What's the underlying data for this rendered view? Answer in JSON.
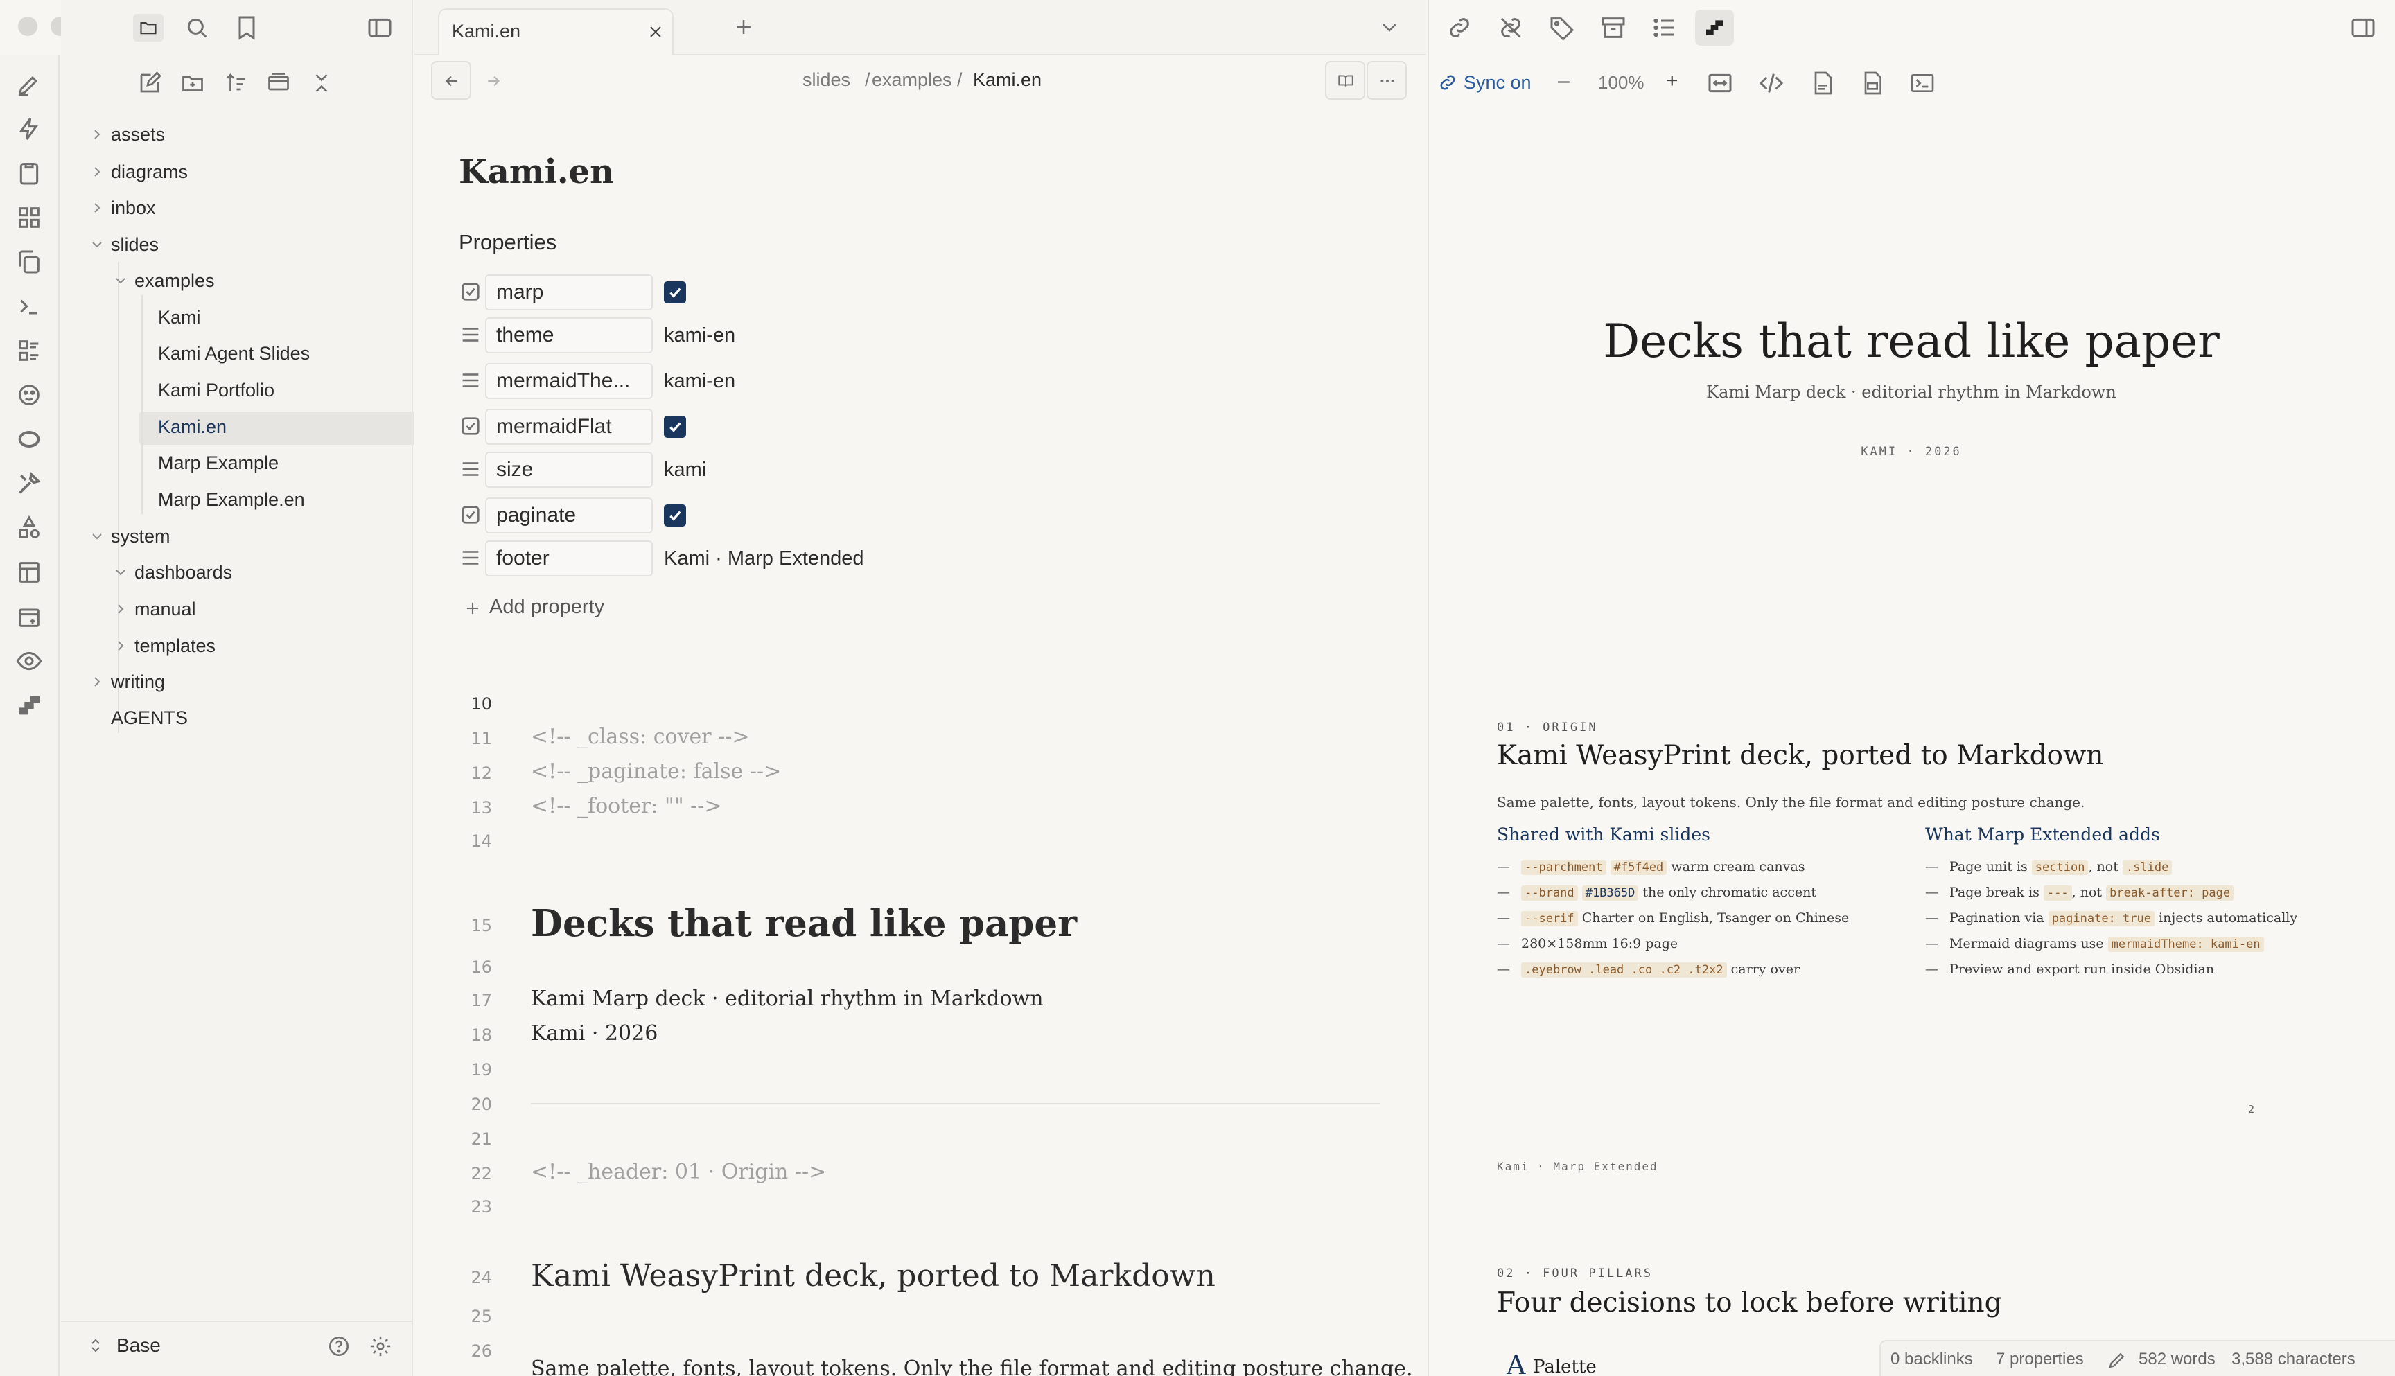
{
  "sidebar": {
    "tree": [
      {
        "label": "assets",
        "type": "folder",
        "expanded": false
      },
      {
        "label": "diagrams",
        "type": "folder",
        "expanded": false
      },
      {
        "label": "inbox",
        "type": "folder",
        "expanded": false
      },
      {
        "label": "slides",
        "type": "folder",
        "expanded": true
      },
      {
        "label": "examples",
        "type": "folder",
        "expanded": true
      },
      {
        "label": "Kami",
        "type": "file"
      },
      {
        "label": "Kami Agent Slides",
        "type": "file"
      },
      {
        "label": "Kami Portfolio",
        "type": "file"
      },
      {
        "label": "Kami.en",
        "type": "file",
        "active": true
      },
      {
        "label": "Marp Example",
        "type": "file"
      },
      {
        "label": "Marp Example.en",
        "type": "file"
      },
      {
        "label": "system",
        "type": "folder",
        "expanded": true
      },
      {
        "label": "dashboards",
        "type": "folder",
        "expanded": true
      },
      {
        "label": "manual",
        "type": "folder",
        "expanded": false
      },
      {
        "label": "templates",
        "type": "folder",
        "expanded": false
      },
      {
        "label": "writing",
        "type": "folder",
        "expanded": false
      },
      {
        "label": "AGENTS",
        "type": "file"
      }
    ],
    "vault_name": "Base"
  },
  "editor": {
    "tab_title": "Kami.en",
    "breadcrumb": [
      "slides",
      "examples",
      "Kami.en"
    ],
    "breadcrumb_sep": "/",
    "note_title": "Kami.en",
    "properties_heading": "Properties",
    "properties": [
      {
        "key": "marp",
        "kind": "checkbox",
        "value": ""
      },
      {
        "key": "theme",
        "kind": "text",
        "value": "kami-en"
      },
      {
        "key": "mermaidThe...",
        "kind": "text",
        "value": "kami-en"
      },
      {
        "key": "mermaidFlat",
        "kind": "checkbox",
        "value": ""
      },
      {
        "key": "size",
        "kind": "text",
        "value": "kami"
      },
      {
        "key": "paginate",
        "kind": "checkbox",
        "value": ""
      },
      {
        "key": "footer",
        "kind": "text",
        "value": "Kami · Marp Extended"
      }
    ],
    "add_property": "Add property",
    "lines": [
      {
        "n": "10",
        "text": ""
      },
      {
        "n": "11",
        "text": "<!-- _class: cover -->"
      },
      {
        "n": "12",
        "text": "<!-- _paginate: false -->"
      },
      {
        "n": "13",
        "text": "<!-- _footer: \"\" -->"
      },
      {
        "n": "14",
        "text": ""
      },
      {
        "n": "15",
        "text": "Decks that read like paper"
      },
      {
        "n": "16",
        "text": ""
      },
      {
        "n": "17",
        "text": "Kami Marp deck · editorial rhythm in Markdown"
      },
      {
        "n": "18",
        "text": "Kami · 2026"
      },
      {
        "n": "19",
        "text": ""
      },
      {
        "n": "20",
        "text": ""
      },
      {
        "n": "21",
        "text": ""
      },
      {
        "n": "22",
        "text": "<!-- _header: 01 · Origin -->"
      },
      {
        "n": "23",
        "text": ""
      },
      {
        "n": "24",
        "text": "Kami WeasyPrint deck, ported to Markdown"
      },
      {
        "n": "25",
        "text": ""
      },
      {
        "n": "26",
        "text": "Same palette, fonts, layout tokens. Only the file format and editing posture change."
      }
    ]
  },
  "preview": {
    "sync_label": "Sync on",
    "zoom": "100%",
    "zoom_minus": "–",
    "zoom_plus": "+",
    "slide1": {
      "title": "Decks that read like paper",
      "subtitle": "Kami Marp deck · editorial rhythm in Markdown",
      "eyebrow": "KAMI · 2026"
    },
    "slide2": {
      "eyebrow": "01 · ORIGIN",
      "title": "Kami WeasyPrint deck, ported to Markdown",
      "lead": "Same palette, fonts, layout tokens. Only the file format and editing posture change.",
      "col1_title": "Shared with Kami slides",
      "col2_title": "What Marp Extended adds",
      "col1": [
        {
          "code": "--parchment",
          "code2": "#f5f4ed",
          "text": "warm cream canvas"
        },
        {
          "code": "--brand",
          "code2": "#1B365D",
          "text": "the only chromatic accent"
        },
        {
          "code": "--serif",
          "code2": "",
          "text": "Charter on English, Tsanger on Chinese"
        },
        {
          "code": "",
          "code2": "",
          "text": "280×158mm 16:9 page"
        },
        {
          "code": ".eyebrow .lead .co .c2 .t2x2",
          "code2": "",
          "text": "carry over"
        }
      ],
      "col2": [
        {
          "pre": "Page unit is",
          "code": "section",
          "mid": ", not",
          "code2": ".slide",
          "post": ""
        },
        {
          "pre": "Page break is",
          "code": "---",
          "mid": ", not",
          "code2": "break-after: page",
          "post": ""
        },
        {
          "pre": "Pagination via",
          "code": "paginate: true",
          "mid": "injects automatically",
          "code2": "",
          "post": ""
        },
        {
          "pre": "Mermaid diagrams use",
          "code": "mermaidTheme: kami-en",
          "mid": "",
          "code2": "",
          "post": ""
        },
        {
          "pre": "Preview and export run inside Obsidian",
          "code": "",
          "mid": "",
          "code2": "",
          "post": ""
        }
      ],
      "page_number": "2",
      "footer": "Kami · Marp Extended"
    },
    "slide3": {
      "eyebrow": "02 · FOUR PILLARS",
      "title": "Four decisions to lock before writing",
      "card_letter": "A",
      "card_title": "Palette"
    }
  },
  "status": {
    "backlinks": "0 backlinks",
    "properties": "7 properties",
    "words": "582 words",
    "characters": "3,588 characters"
  },
  "colors": {
    "brand": "#1B365D",
    "parchment": "#f5f4ed",
    "accent_link": "#2b5a9e"
  }
}
